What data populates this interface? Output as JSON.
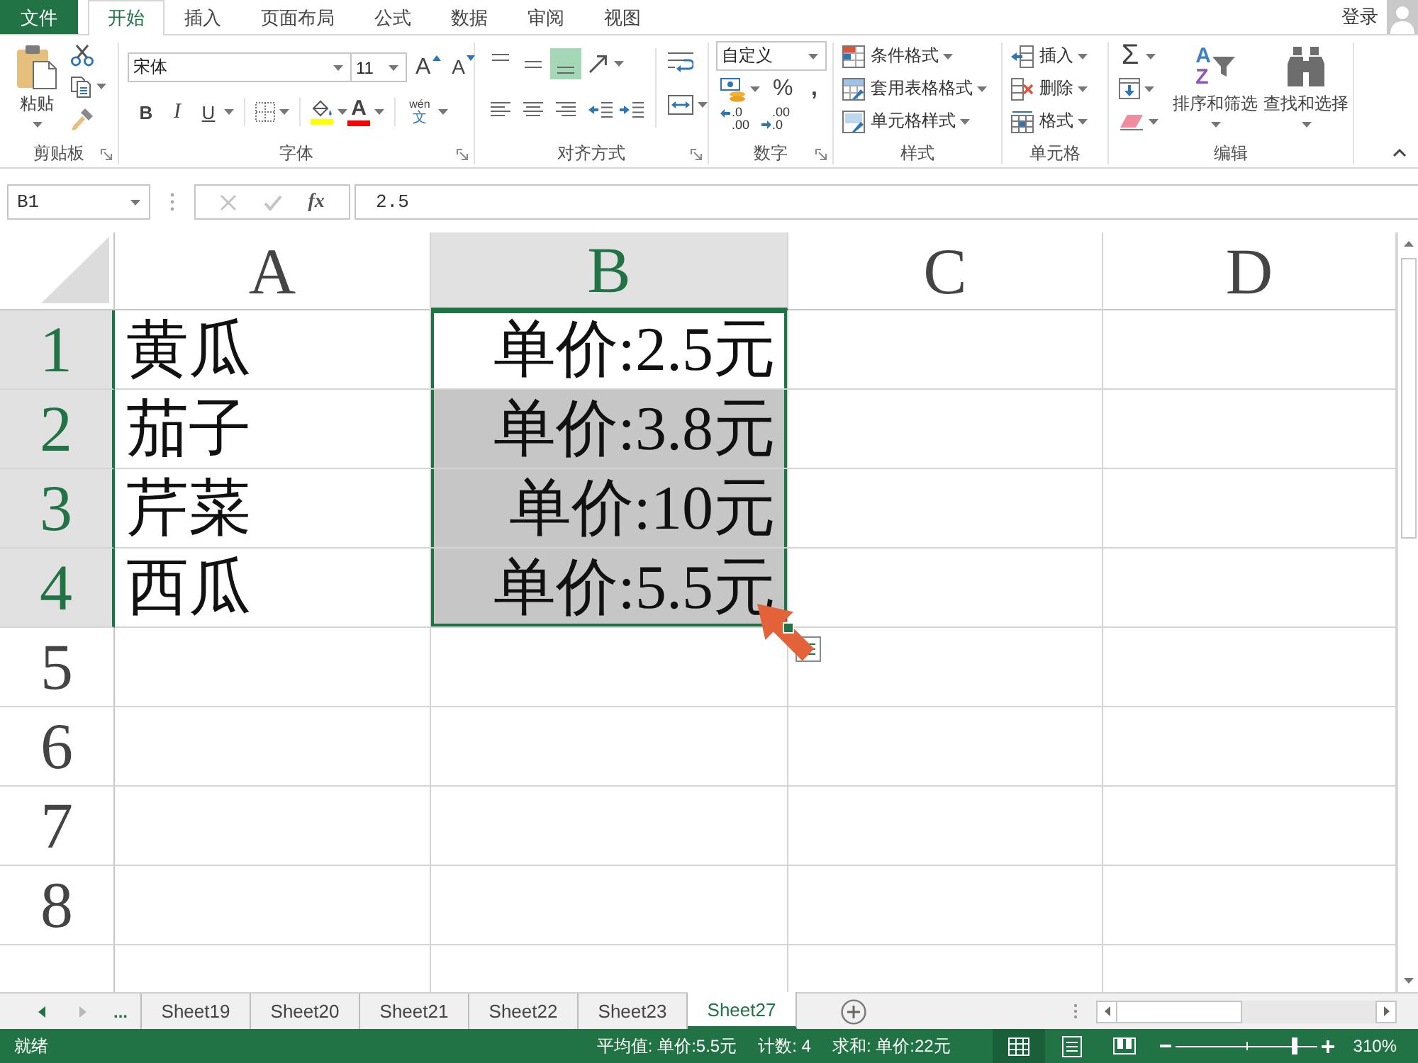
{
  "tabs": [
    {
      "label": "文件",
      "kind": "file",
      "selected": false
    },
    {
      "label": "开始",
      "kind": "tab",
      "selected": true
    },
    {
      "label": "插入",
      "kind": "tab",
      "selected": false
    },
    {
      "label": "页面布局",
      "kind": "tab",
      "selected": false
    },
    {
      "label": "公式",
      "kind": "tab",
      "selected": false
    },
    {
      "label": "数据",
      "kind": "tab",
      "selected": false
    },
    {
      "label": "审阅",
      "kind": "tab",
      "selected": false
    },
    {
      "label": "视图",
      "kind": "tab",
      "selected": false
    }
  ],
  "account": {
    "label": "登录"
  },
  "ribbon": {
    "clipboard": {
      "title": "剪贴板",
      "paste": "粘贴"
    },
    "font": {
      "title": "字体",
      "font_name": "宋体",
      "font_size": "11",
      "grow_font": "A",
      "shrink_font": "A",
      "bold": "B",
      "italic": "I",
      "underline": "U",
      "fill_color": {
        "color": "#ffff00"
      },
      "font_color": {
        "label": "A",
        "color": "#ff0000"
      },
      "phonetic": {
        "pinyin": "wén",
        "character": "文"
      }
    },
    "alignment": {
      "title": "对齐方式",
      "vertical": [
        {
          "kind": "top",
          "selected": false
        },
        {
          "kind": "middle",
          "selected": false
        },
        {
          "kind": "bottom",
          "selected": true
        }
      ],
      "horizontal": [
        {
          "kind": "left",
          "selected": false
        },
        {
          "kind": "center",
          "selected": false
        },
        {
          "kind": "right",
          "selected": false
        }
      ]
    },
    "number": {
      "title": "数字",
      "format": "自定义",
      "percent": "%",
      "comma": ",",
      "increase_decimal": {
        "upper": ".0",
        "lower": ".00"
      },
      "decrease_decimal": {
        "upper": ".00",
        "lower": ".0"
      }
    },
    "styles": {
      "title": "样式",
      "items": [
        "条件格式",
        "套用表格格式",
        "单元格样式"
      ]
    },
    "cells": {
      "title": "单元格",
      "items": [
        {
          "kind": "insert",
          "label": "插入"
        },
        {
          "kind": "delete",
          "label": "删除"
        },
        {
          "kind": "format",
          "label": "格式"
        }
      ]
    },
    "editing": {
      "title": "编辑",
      "autosum": "Σ",
      "sort": {
        "label": "排序和筛选",
        "glyphs": [
          "A",
          "Z"
        ]
      },
      "find": "查找和选择"
    }
  },
  "formula_bar": {
    "name_box": "B1",
    "buttons": [
      {
        "kind": "cancel",
        "disabled": true
      },
      {
        "kind": "enter",
        "disabled": true
      }
    ],
    "function_label": "fx",
    "formula": "2.5"
  },
  "sheet": {
    "columns": [
      {
        "label": "A",
        "selected": false
      },
      {
        "label": "B",
        "selected": true
      },
      {
        "label": "C",
        "selected": false
      },
      {
        "label": "D",
        "selected": false
      }
    ],
    "rows": [
      {
        "header": "1",
        "selected": true,
        "cells": [
          {
            "text": "黄瓜",
            "kind": "text",
            "selected": false,
            "active": false
          },
          {
            "text": "单价:2.5元",
            "kind": "number",
            "selected": true,
            "active": true
          }
        ]
      },
      {
        "header": "2",
        "selected": true,
        "cells": [
          {
            "text": "茄子",
            "kind": "text",
            "selected": false,
            "active": false
          },
          {
            "text": "单价:3.8元",
            "kind": "number",
            "selected": true,
            "active": false
          }
        ]
      },
      {
        "header": "3",
        "selected": true,
        "cells": [
          {
            "text": "芹菜",
            "kind": "text",
            "selected": false,
            "active": false
          },
          {
            "text": "单价:10元",
            "kind": "number",
            "selected": true,
            "active": false
          }
        ]
      },
      {
        "header": "4",
        "selected": true,
        "cells": [
          {
            "text": "西瓜",
            "kind": "text",
            "selected": false,
            "active": false
          },
          {
            "text": "单价:5.5元",
            "kind": "number",
            "selected": true,
            "active": false
          }
        ]
      },
      {
        "header": "5",
        "selected": false
      },
      {
        "header": "6",
        "selected": false
      },
      {
        "header": "7",
        "selected": false
      },
      {
        "header": "8",
        "selected": false
      },
      {
        "selected": false
      }
    ]
  },
  "sheet_tabs": {
    "navigation": [
      {
        "kind": "previous",
        "disabled": false
      },
      {
        "kind": "next",
        "disabled": true
      }
    ],
    "overflow": "...",
    "tabs": [
      {
        "label": "Sheet19",
        "selected": false
      },
      {
        "label": "Sheet20",
        "selected": false
      },
      {
        "label": "Sheet21",
        "selected": false
      },
      {
        "label": "Sheet22",
        "selected": false
      },
      {
        "label": "Sheet23",
        "selected": false
      },
      {
        "label": "Sheet27",
        "selected": true
      }
    ]
  },
  "status_bar": {
    "status": "就绪",
    "average": "平均值: 单价:5.5元",
    "count": "计数: 4",
    "sum": "求和: 单价:22元",
    "views": [
      {
        "kind": "normal",
        "selected": true
      },
      {
        "kind": "page_layout",
        "selected": false
      },
      {
        "kind": "page_break",
        "selected": false
      }
    ],
    "zoom": {
      "level": 0.84,
      "reading": "310%"
    }
  }
}
